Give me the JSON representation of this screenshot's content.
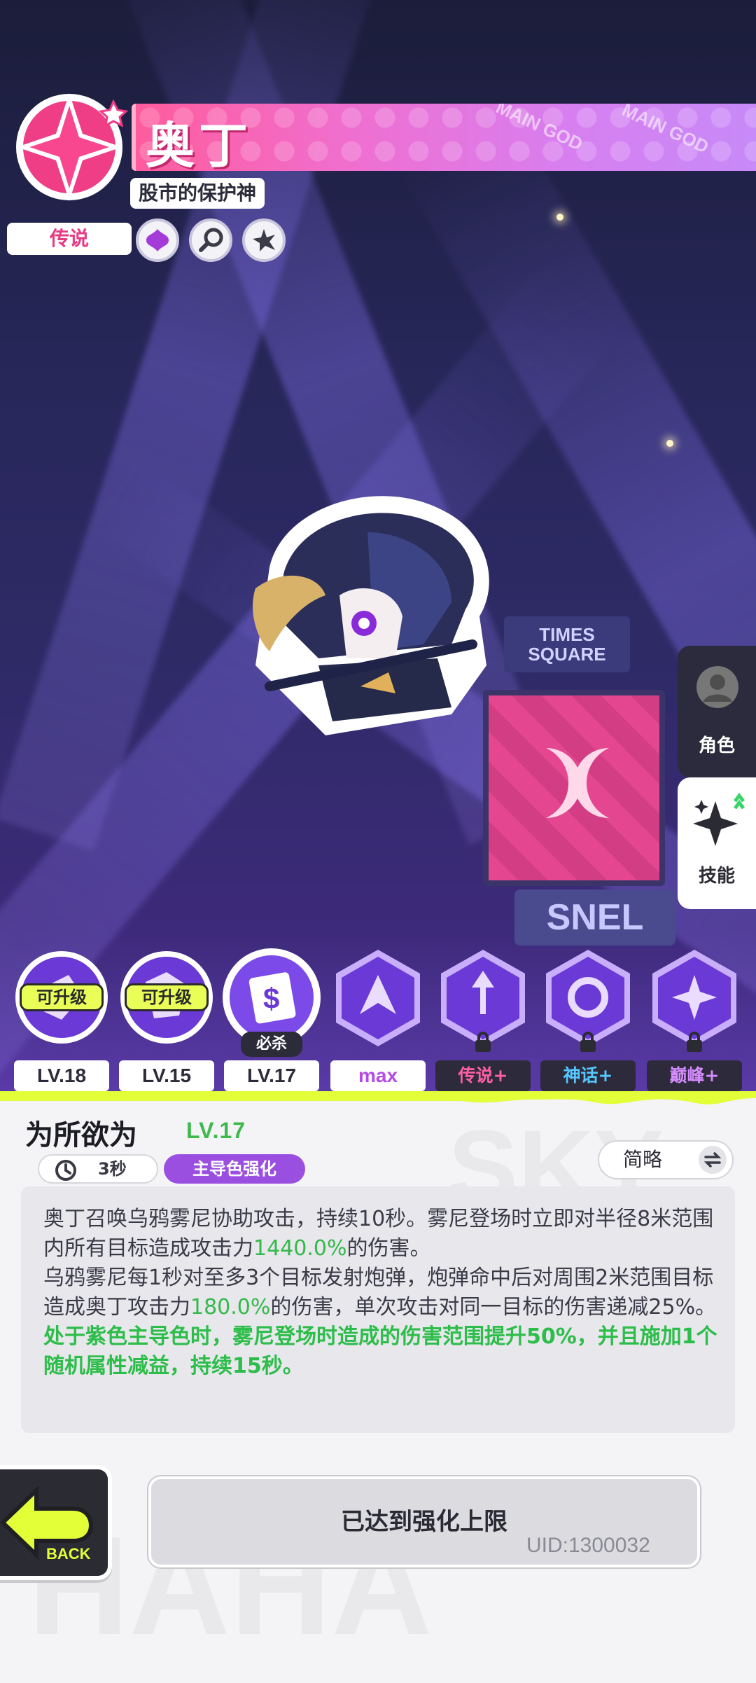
{
  "hero": {
    "name": "奥丁",
    "title": "股市的保护神",
    "rarity": "传说",
    "banner_watermark": "MAIN GOD"
  },
  "scene": {
    "billboard_top": "TIMES SQUARE",
    "billboard_bottom": "SNEL"
  },
  "side_tabs": {
    "character": "角色",
    "skills": "技能"
  },
  "skills_row": {
    "items": [
      {
        "badge": "可升级",
        "level": "LV.18"
      },
      {
        "badge": "可升级",
        "level": "LV.15"
      },
      {
        "tag": "必杀",
        "level": "LV.17"
      },
      {
        "level": "max"
      },
      {
        "level": "传说+",
        "locked": true
      },
      {
        "level": "神话+",
        "locked": true
      },
      {
        "level": "巅峰+",
        "locked": true
      }
    ]
  },
  "detail": {
    "skill_name": "为所欲为",
    "skill_level": "LV.17",
    "cooldown": "3秒",
    "role_tag": "主导色强化",
    "brief_toggle": "简略",
    "desc": {
      "p1_a": "奥丁召唤乌鸦雾尼协助攻击，持续10秒。雾尼登场时立即对半径8米范围内所有目标造成攻击力",
      "p1_num": "1440.0%",
      "p1_b": "的伤害。",
      "p2_a": "乌鸦雾尼每1秒对至多3个目标发射炮弹，炮弹命中后对周围2米范围目标造成奥丁攻击力",
      "p2_num": "180.0%",
      "p2_b": "的伤害，单次攻击对同一目标的伤害递减25%。",
      "p3": "处于紫色主导色时，雾尼登场时造成的伤害范围提升50%，并且施加1个随机属性减益，持续15秒。"
    },
    "max_button": "已达到强化上限",
    "back_label": "BACK",
    "uid": "UID:1300032"
  },
  "colors": {
    "accent_pink": "#e63a83",
    "accent_purple": "#9a4fe0",
    "highlight_green": "#34b94a",
    "badge_yellow": "#e9ff57"
  }
}
